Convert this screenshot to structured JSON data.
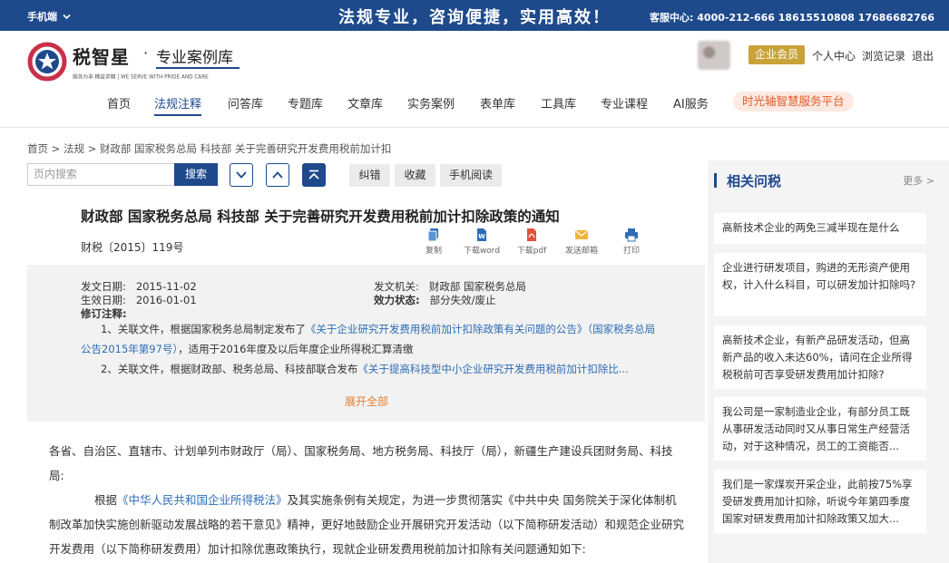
{
  "topbar": {
    "mobile_label": "手机端",
    "slogan": "法规专业，咨询便捷，实用高效！",
    "hotline": "客服中心:  4000-212-666 18615510808 17686682766"
  },
  "logo": {
    "brand": "税智星",
    "dot": "·",
    "subtitle": "专业案例库",
    "tagline": "服务为本·精益求精 | WE SERVE WITH PRIDE AND CARE"
  },
  "user": {
    "member_label": "企业会员",
    "links": [
      "个人中心",
      "浏览记录",
      "退出"
    ]
  },
  "nav": {
    "items": [
      "首页",
      "法规注释",
      "问答库",
      "专题库",
      "文章库",
      "实务案例",
      "表单库",
      "工具库",
      "专业课程",
      "AI服务"
    ],
    "active_index": 1,
    "platform": "时光轴智慧服务平台"
  },
  "breadcrumb": "首页 > 法规 > 财政部 国家税务总局 科技部 关于完善研究开发费用税前加计扣",
  "toolbar": {
    "search_placeholder": "页内搜索",
    "search_button": "搜索",
    "buttons": [
      "纠错",
      "收藏",
      "手机阅读"
    ]
  },
  "doc": {
    "title": "财政部 国家税务总局 科技部 关于完善研究开发费用税前加计扣除政策的通知",
    "number": "财税〔2015〕119号",
    "actions": [
      "复制",
      "下载word",
      "下载pdf",
      "发送邮箱",
      "打印"
    ],
    "meta": {
      "issue_date_label": "发文日期:",
      "issue_date": "2015-11-02",
      "effective_date_label": "生效日期:",
      "effective_date": "2016-01-01",
      "issuer_label": "发文机关:",
      "issuer": "财政部 国家税务总局",
      "status_label": "效力状态:",
      "status": "部分失效/废止",
      "revision_label": "修订注释:"
    },
    "notes": {
      "n1_prefix": "1、关联文件，根据国家税务总局制定发布了",
      "n1_link": "《关于企业研究开发费用税前加计扣除政策有关问题的公告》（国家税务总局公告2015年第97号）",
      "n1_suffix": "，适用于2016年度及以后年度企业所得税汇算清缴",
      "n2_prefix": "2、关联文件，根据财政部、税务总局、科技部联合发布",
      "n2_link": "《关于提高科技型中小企业研究开发费用税前加计扣除比..."
    },
    "expand_label": "展开全部",
    "body": {
      "p1": "各省、自治区、直辖市、计划单列市财政厅（局）、国家税务局、地方税务局、科技厅（局），新疆生产建设兵团财务局、科技局:",
      "p2_prefix": "根据",
      "p2_link": "《中华人民共和国企业所得税法》",
      "p2_suffix": "及其实施条例有关规定，为进一步贯彻落实《中共中央 国务院关于深化体制机制改革加快实施创新驱动发展战略的若干意见》精神，更好地鼓励企业开展研究开发活动（以下简称研发活动）和规范企业研究开发费用（以下简称研发费用）加计扣除优惠政策执行，现就企业研发费用税前加计扣除有关问题通知如下:"
    }
  },
  "sidebar": {
    "title": "相关问税",
    "more": "更多 >",
    "questions": [
      "高新技术企业的两免三减半现在是什么",
      "企业进行研发项目，购进的无形资产使用权，计入什么科目，可以研发加计扣除吗?",
      "高新技术企业，有新产品研发活动，但高新产品的收入未达60%，请问在企业所得税税前可否享受研发费用加计扣除?",
      "我公司是一家制造业企业，有部分员工既从事研发活动同时又从事日常生产经营活动，对于这种情况，员工的工资能否...",
      "我们是一家煤炭开采企业，此前按75%享受研发费用加计扣除，听说今年第四季度国家对研发费用加计扣除政策又加大..."
    ]
  },
  "colors": {
    "primary": "#1e4a8c",
    "member_gold": "#c9a338",
    "link": "#2d6db5",
    "expand": "#e27f2e",
    "platform_text": "#e05a2a"
  }
}
